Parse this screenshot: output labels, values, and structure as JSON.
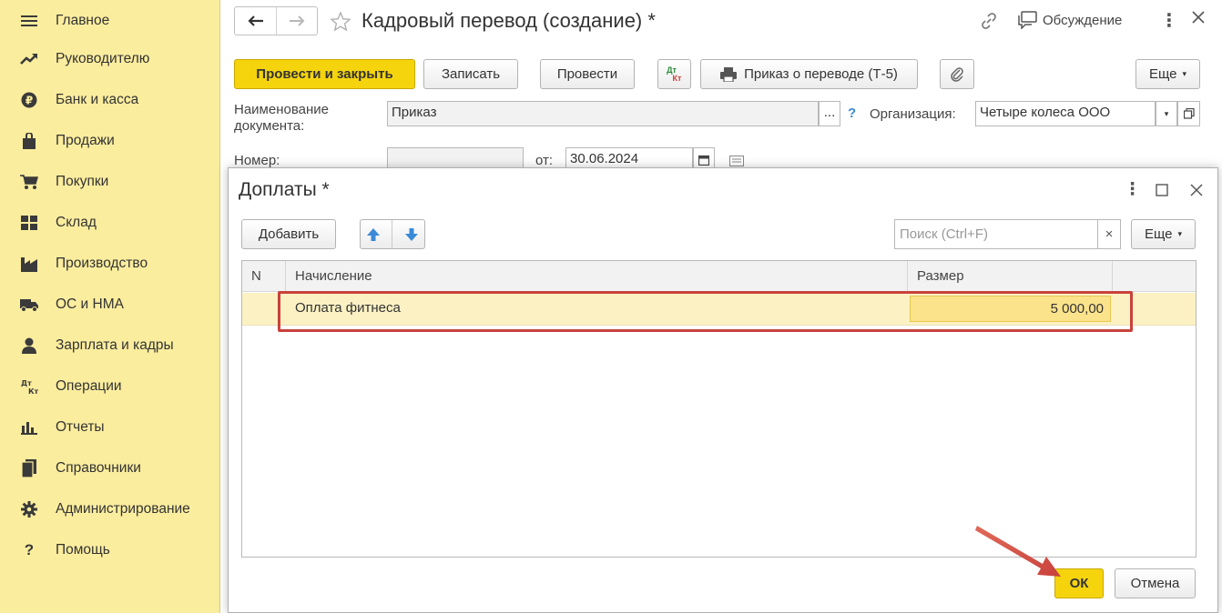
{
  "sidebar": {
    "items": [
      {
        "label": "Главное",
        "icon": "menu-icon"
      },
      {
        "label": "Руководителю",
        "icon": "trend-icon"
      },
      {
        "label": "Банк и касса",
        "icon": "ruble-icon"
      },
      {
        "label": "Продажи",
        "icon": "bag-icon"
      },
      {
        "label": "Покупки",
        "icon": "cart-icon"
      },
      {
        "label": "Склад",
        "icon": "warehouse-icon"
      },
      {
        "label": "Производство",
        "icon": "factory-icon"
      },
      {
        "label": "ОС и НМА",
        "icon": "truck-icon"
      },
      {
        "label": "Зарплата и кадры",
        "icon": "person-icon"
      },
      {
        "label": "Операции",
        "icon": "dt-kt-icon"
      },
      {
        "label": "Отчеты",
        "icon": "bar-chart-icon"
      },
      {
        "label": "Справочники",
        "icon": "books-icon"
      },
      {
        "label": "Администрирование",
        "icon": "gear-icon"
      },
      {
        "label": "Помощь",
        "icon": "question-icon"
      }
    ]
  },
  "header": {
    "title": "Кадровый перевод (создание) *",
    "discussion": "Обсуждение"
  },
  "toolbar": {
    "post_close": "Провести и закрыть",
    "save": "Записать",
    "post": "Провести",
    "dt_kt_top": "Дт",
    "dt_kt_bottom": "Кт",
    "print_order": "Приказ о переводе (Т-5)",
    "more": "Еще"
  },
  "form": {
    "name_label_line1": "Наименование",
    "name_label_line2": "документа:",
    "name_value": "Приказ",
    "dots": "...",
    "help": "?",
    "org_label": "Организация:",
    "org_value": "Четыре колеса ООО",
    "number_label": "Номер:",
    "number_value": "",
    "date_label": "от:",
    "date_value": "30.06.2024"
  },
  "dialog": {
    "title": "Доплаты *",
    "add": "Добавить",
    "search_placeholder": "Поиск (Ctrl+F)",
    "search_clear": "×",
    "more": "Еще",
    "columns": {
      "n": "N",
      "accrual": "Начисление",
      "amount": "Размер"
    },
    "rows": [
      {
        "n": "",
        "accrual": "Оплата фитнеса",
        "amount": "5 000,00"
      }
    ],
    "ok": "ОК",
    "cancel": "Отмена"
  },
  "colors": {
    "sidebar_bg": "#fbed9e",
    "accent_yellow": "#f5d40e",
    "selected_row": "#fbf1c3",
    "highlight_red": "#c9423c",
    "arrow_blue": "#3a8ad8"
  }
}
